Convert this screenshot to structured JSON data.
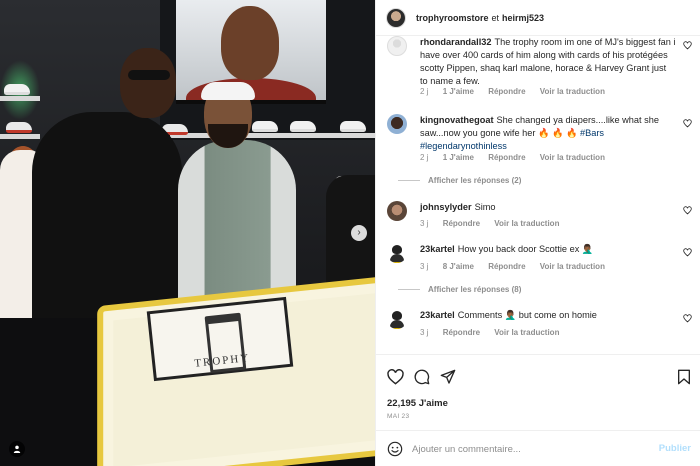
{
  "header": {
    "user": "trophyroomstore",
    "separator": "et",
    "collaborator": "heirmj523"
  },
  "comments": [
    {
      "user": "rhondarandall32",
      "text": "The trophy room im one of MJ's biggest fan i have over 400 cards of him along with cards of his protégées scotty Pippen, shaq karl malone, horace & Harvey Grant just to name a few.",
      "time": "2 j",
      "likes": "1 J'aime",
      "reply": "Répondre",
      "translate": "Voir la traduction"
    },
    {
      "user": "kingnovathegoat",
      "text_before": "She changed ya diapers....like what she saw...now you gone wife her",
      "emoji": "🔥 🔥 🔥",
      "tags": "#Bars #legendarynothinless",
      "time": "2 j",
      "likes": "1 J'aime",
      "reply": "Répondre",
      "translate": "Voir la traduction",
      "view_replies": "Afficher les réponses (2)"
    },
    {
      "user": "johnsylyder",
      "text": "Simo",
      "time": "3 j",
      "reply": "Répondre",
      "translate": "Voir la traduction"
    },
    {
      "user": "23kartel",
      "text": "How you back door Scottie ex",
      "emoji": "🤦🏾‍♂️",
      "time": "3 j",
      "likes": "8 J'aime",
      "reply": "Répondre",
      "translate": "Voir la traduction",
      "view_replies": "Afficher les réponses (8)"
    },
    {
      "user": "23kartel",
      "text": "Comments",
      "emoji": "🤦🏾‍♂️",
      "text_after": "but come on homie",
      "time": "3 j",
      "reply": "Répondre",
      "translate": "Voir la traduction"
    }
  ],
  "actions": {
    "like_count": "22,195 J'aime",
    "date": "MAI 23"
  },
  "add_comment": {
    "placeholder": "Ajouter un commentaire...",
    "post_label": "Publier"
  },
  "photo": {
    "cake_text": "TROPHY"
  },
  "icons": {
    "heart": "heart-icon",
    "comment": "comment-icon",
    "share": "paper-plane-icon",
    "save": "bookmark-icon",
    "emoji": "emoji-icon",
    "next": "chevron-right-icon",
    "tag": "person-icon"
  },
  "colors": {
    "text": "#262626",
    "muted": "#8e8e8e",
    "link": "#00376b",
    "post_disabled": "#b2dffc"
  }
}
